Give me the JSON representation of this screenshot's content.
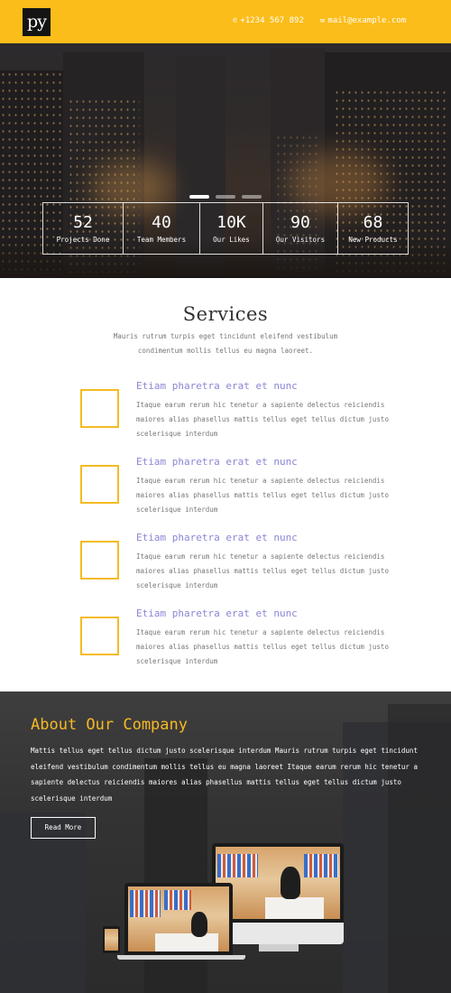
{
  "header": {
    "logo": "py",
    "phone_icon": "phone-icon",
    "phone": "+1234 567 892",
    "email_icon": "mail-icon",
    "email": "mail@example.com",
    "accent_color": "#fbbd1a"
  },
  "hero": {
    "slides_count": 3,
    "active_slide": 1,
    "stats": [
      {
        "num": "52",
        "label": "Projects Done"
      },
      {
        "num": "40",
        "label": "Team Members"
      },
      {
        "num": "10K",
        "label": "Our Likes"
      },
      {
        "num": "90",
        "label": "Our Visitors"
      },
      {
        "num": "68",
        "label": "New Products"
      }
    ]
  },
  "services": {
    "title": "Services",
    "subtitle": "Mauris rutrum turpis eget tincidunt eleifend vestibulum condimentum mollis tellus eu magna laoreet.",
    "items": [
      {
        "title": "Etiam pharetra erat et nunc",
        "text": "Itaque earum rerum hic tenetur a sapiente delectus reiciendis maiores alias phasellus mattis tellus eget tellus dictum justo scelerisque interdum"
      },
      {
        "title": "Etiam pharetra erat et nunc",
        "text": "Itaque earum rerum hic tenetur a sapiente delectus reiciendis maiores alias phasellus mattis tellus eget tellus dictum justo scelerisque interdum"
      },
      {
        "title": "Etiam pharetra erat et nunc",
        "text": "Itaque earum rerum hic tenetur a sapiente delectus reiciendis maiores alias phasellus mattis tellus eget tellus dictum justo scelerisque interdum"
      },
      {
        "title": "Etiam pharetra erat et nunc",
        "text": "Itaque earum rerum hic tenetur a sapiente delectus reiciendis maiores alias phasellus mattis tellus eget tellus dictum justo scelerisque interdum"
      }
    ],
    "title_color": "#8b86d6",
    "box_color": "#f4bb22"
  },
  "about": {
    "title": "About Our Company",
    "text": "Mattis tellus eget tellus dictum justo scelerisque interdum Mauris rutrum turpis eget tincidunt eleifend vestibulum condimentum mollis tellus eu magna laoreet Itaque earum rerum hic tenetur a sapiente delectus reiciendis maiores alias phasellus mattis tellus eget tellus dictum justo scelerisque interdum",
    "button": "Read More",
    "title_color": "#f6b924"
  }
}
